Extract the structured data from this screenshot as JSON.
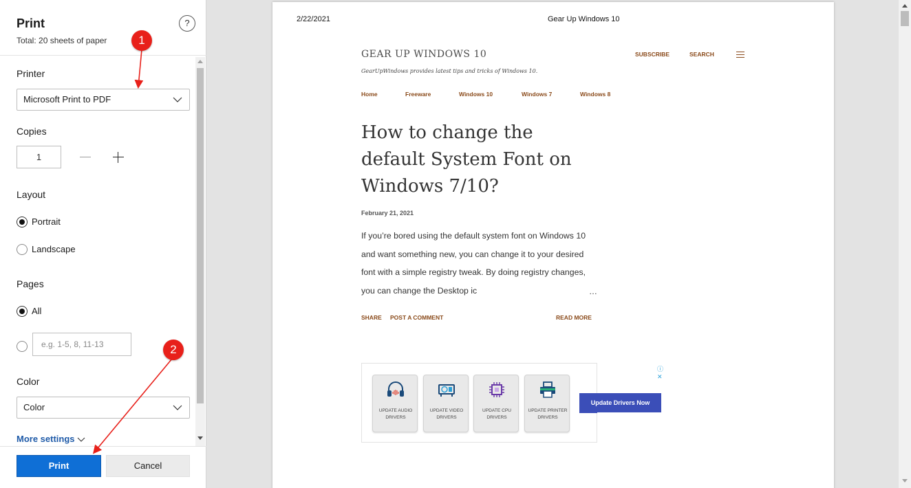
{
  "panel": {
    "title": "Print",
    "subtitle": "Total: 20 sheets of paper",
    "help_label": "?",
    "printer": {
      "label": "Printer",
      "value": "Microsoft Print to PDF"
    },
    "copies": {
      "label": "Copies",
      "value": "1"
    },
    "layout": {
      "label": "Layout",
      "options": [
        "Portrait",
        "Landscape"
      ],
      "selected": "Portrait"
    },
    "pages": {
      "label": "Pages",
      "all_label": "All",
      "range_placeholder": "e.g. 1-5, 8, 11-13",
      "selected": "All"
    },
    "color": {
      "label": "Color",
      "value": "Color"
    },
    "more_settings": "More settings",
    "print_label": "Print",
    "cancel_label": "Cancel"
  },
  "preview": {
    "header_date": "2/22/2021",
    "header_title": "Gear Up Windows 10",
    "site_name": "GEAR UP WINDOWS 10",
    "tagline": "GearUpWindows provides latest tips and tricks of Windows 10.",
    "top_links": [
      "SUBSCRIBE",
      "SEARCH"
    ],
    "menu": [
      "Home",
      "Freeware",
      "Windows 10",
      "Windows 7",
      "Windows 8"
    ],
    "post_title": "How to change the default System Font on Windows 7/10?",
    "post_date": "February 21, 2021",
    "post_excerpt": "If you’re bored using the default system font on Windows 10 and want something new, you can change it to your desired font with a simple registry tweak. By doing registry changes, you can change the Desktop ic",
    "ellipsis": "…",
    "actions": {
      "share": "SHARE",
      "comment": "POST A COMMENT",
      "read_more": "READ MORE"
    },
    "ad": {
      "cards": [
        {
          "label": "UPDATE AUDIO DRIVERS",
          "icon": "headphones-icon"
        },
        {
          "label": "UPDATE VIDEO DRIVERS",
          "icon": "video-card-icon"
        },
        {
          "label": "UPDATE CPU DRIVERS",
          "icon": "cpu-icon"
        },
        {
          "label": "UPDATE PRINTER DRIVERS",
          "icon": "printer-icon"
        }
      ],
      "button": "Update Drivers Now",
      "choices_label": "ⓘ ✕"
    }
  },
  "annotations": [
    "1",
    "2"
  ],
  "colors": {
    "print_button": "#0f6fd6",
    "link": "#8a4a1a",
    "annotation": "#e8201a",
    "ad_button": "#3b4eb8"
  }
}
